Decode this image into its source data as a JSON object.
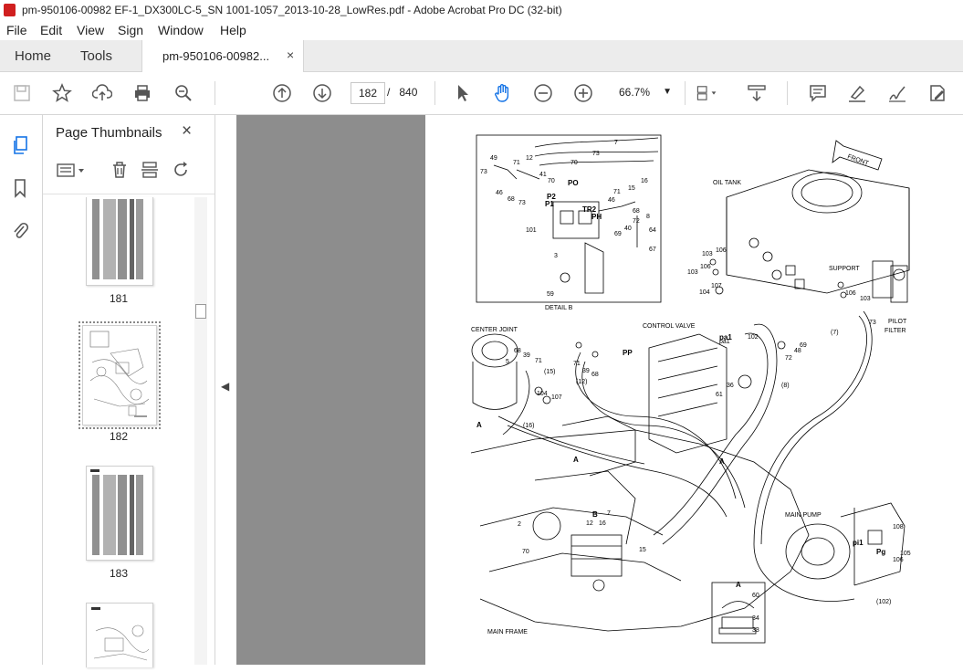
{
  "window": {
    "title": "pm-950106-00982 EF-1_DX300LC-5_SN 1001-1057_2013-10-28_LowRes.pdf - Adobe Acrobat Pro DC (32-bit)"
  },
  "menu": {
    "items": [
      "File",
      "Edit",
      "View",
      "Sign",
      "Window",
      "Help"
    ]
  },
  "tabs": {
    "home": "Home",
    "tools": "Tools",
    "document": "pm-950106-00982...",
    "close": "×"
  },
  "toolbar": {
    "page_current": "182",
    "page_separator": "/",
    "page_total": "840",
    "zoom": "66.7%",
    "icons": [
      "save-icon",
      "bookmark-star-icon",
      "upload-icon",
      "print-icon",
      "zoom-search-icon",
      "page-up-icon",
      "page-down-icon",
      "select-arrow-icon",
      "hand-tool-icon",
      "zoom-out-icon",
      "zoom-in-icon",
      "page-display-icon",
      "scrolling-icon",
      "comment-icon",
      "highlight-icon",
      "sign-icon",
      "edit-pdf-icon"
    ]
  },
  "sidebar": {
    "title": "Page Thumbnails",
    "close": "×",
    "thumbnails": [
      {
        "page": "181",
        "selected": false
      },
      {
        "page": "182",
        "selected": true
      },
      {
        "page": "183",
        "selected": false
      },
      {
        "page": "",
        "selected": false
      }
    ]
  },
  "diagram": {
    "labels": {
      "detail_b": "DETAIL B",
      "oil_tank": "OIL TANK",
      "front": "FRONT",
      "support": "SUPPORT",
      "pilot_filter_1": "PILOT",
      "pilot_filter_2": "FILTER",
      "center_joint": "CENTER JOINT",
      "control_valve": "CONTROL VALVE",
      "main_pump": "MAIN PUMP",
      "main_frame": "MAIN FRAME",
      "port_p1": "P1",
      "port_p2": "P2",
      "port_po": "PO",
      "port_tr2": "TR2",
      "port_ph": "PH",
      "port_pp": "PP",
      "port_pa1": "pa1",
      "port_pi1": "pi1",
      "port_pg": "Pg",
      "section_a1": "A",
      "section_a2": "A",
      "section_a3": "A",
      "section_a4": "A",
      "section_b": "B"
    },
    "callouts": [
      "49",
      "73",
      "71",
      "12",
      "41",
      "70",
      "73",
      "7",
      "46",
      "68",
      "73",
      "70",
      "16",
      "15",
      "46",
      "71",
      "68",
      "72",
      "8",
      "40",
      "69",
      "64",
      "67",
      "101",
      "3",
      "59",
      "103",
      "106",
      "103",
      "106",
      "104",
      "107",
      "106",
      "103",
      "(7)",
      "73",
      "102",
      "pa1",
      "48",
      "72",
      "69",
      "(8)",
      "36",
      "61",
      "68",
      "39",
      "5",
      "71",
      "104",
      "107",
      "(16)",
      "71",
      "39",
      "68",
      "(15)",
      "(12)",
      "2",
      "70",
      "12",
      "16",
      "7",
      "15",
      "108",
      "105",
      "106",
      "(102)",
      "60",
      "34",
      "33"
    ]
  }
}
